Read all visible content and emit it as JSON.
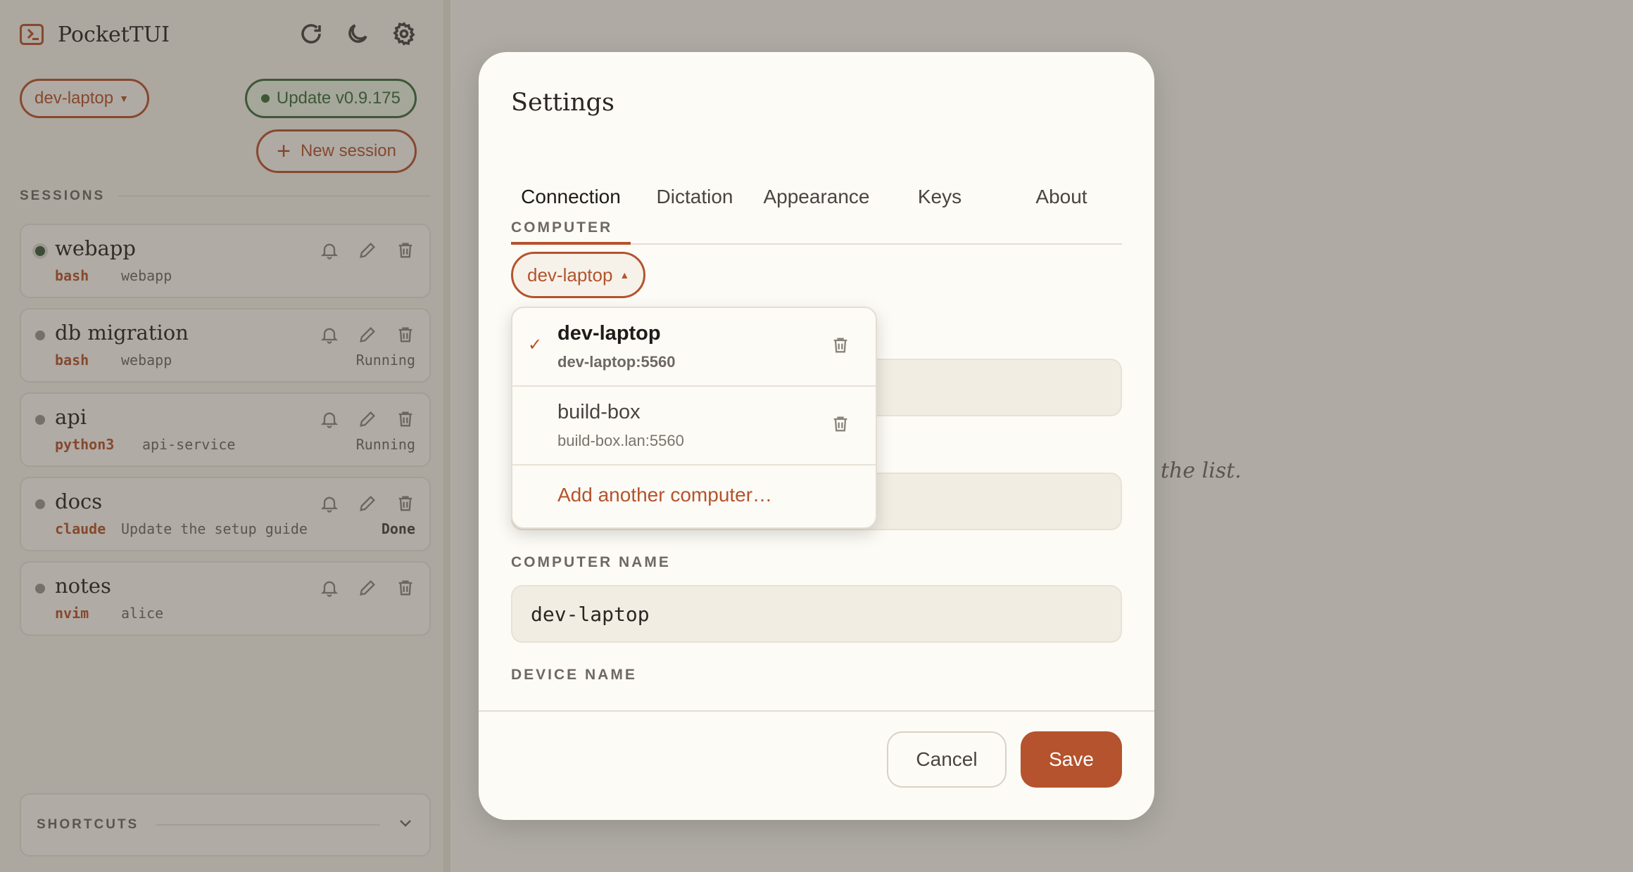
{
  "app": {
    "title": "PocketTUI"
  },
  "sidebar": {
    "computer": "dev-laptop",
    "update_label": "Update v0.9.175",
    "new_session_label": "New session",
    "sessions_heading": "SESSIONS",
    "shortcuts_heading": "SHORTCUTS",
    "sessions": [
      {
        "name": "webapp",
        "cmd": "bash",
        "dir": "webapp",
        "status": "",
        "active": true
      },
      {
        "name": "db migration",
        "cmd": "bash",
        "dir": "webapp",
        "status": "Running",
        "active": false
      },
      {
        "name": "api",
        "cmd": "python3",
        "dir": "api-service",
        "status": "Running",
        "active": false
      },
      {
        "name": "docs",
        "cmd": "claude",
        "dir": "Update the setup guide",
        "status": "Done",
        "active": false
      },
      {
        "name": "notes",
        "cmd": "nvim",
        "dir": "alice",
        "status": "",
        "active": false
      }
    ]
  },
  "main": {
    "hint_fragment": "n the list."
  },
  "modal": {
    "title": "Settings",
    "tabs": [
      "Connection",
      "Dictation",
      "Appearance",
      "Keys",
      "About"
    ],
    "active_tab": "Connection",
    "computer_label": "COMPUTER",
    "computer_value": "dev-laptop",
    "computer_name_label": "COMPUTER NAME",
    "computer_name_value": "dev-laptop",
    "device_name_label": "DEVICE NAME",
    "cancel_label": "Cancel",
    "save_label": "Save"
  },
  "dropdown": {
    "items": [
      {
        "name": "dev-laptop",
        "address": "dev-laptop:5560",
        "selected": true
      },
      {
        "name": "build-box",
        "address": "build-box.lan:5560",
        "selected": false
      }
    ],
    "check_glyph": "✓",
    "add_label": "Add another computer…"
  },
  "colors": {
    "accent": "#b4532d",
    "update_green": "#3e6b3a",
    "background": "#f6f2ea"
  }
}
